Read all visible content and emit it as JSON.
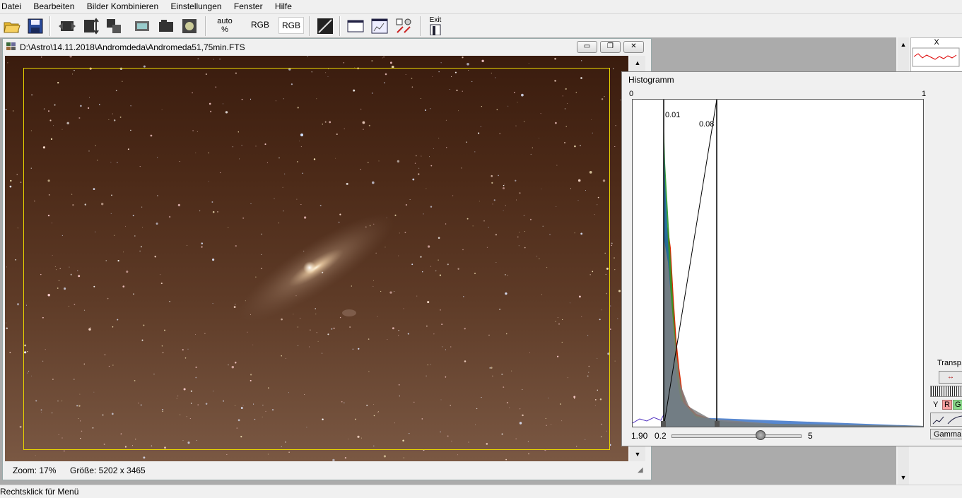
{
  "menu": [
    "Datei",
    "Bearbeiten",
    "Bilder Kombinieren",
    "Einstellungen",
    "Fenster",
    "Hilfe"
  ],
  "toolbar": {
    "auto_top": "auto",
    "auto_bottom": "%",
    "rgb1": "RGB",
    "rgb2": "RGB",
    "exit": "Exit",
    "icons": [
      "open-folder-icon",
      "save-icon",
      "split-channels-icon",
      "flip-icon",
      "combine-icon",
      "crop-icon",
      "camera-icon",
      "hand-tool-icon",
      "gradient-icon",
      "window-icon",
      "histogram-window-icon",
      "settings-tool-icon"
    ]
  },
  "image_window": {
    "title": "D:\\Astro\\14.11.2018\\Andromdeda\\Andromeda51,75min.FTS",
    "zoom": "Zoom: 17%",
    "size": "Größe: 5202 x 3465"
  },
  "histogram": {
    "title": "Histogramm",
    "axis_min": "0",
    "axis_max": "1",
    "marker_low": "0.01",
    "marker_high": "0.08",
    "gamma": "1.90",
    "slider_min": "0.2",
    "slider_max": "5",
    "transp_label": "Transp.",
    "channels": [
      "Y",
      "R",
      "G"
    ],
    "gamma_button": "Gamma",
    "colors": {
      "red": "#d82a00",
      "green": "#2a9a2a",
      "blue": "#2060c0",
      "gray": "#808080"
    }
  },
  "right_panel": {
    "mini_label": "X"
  },
  "status": "Rechtsklick für Menü"
}
